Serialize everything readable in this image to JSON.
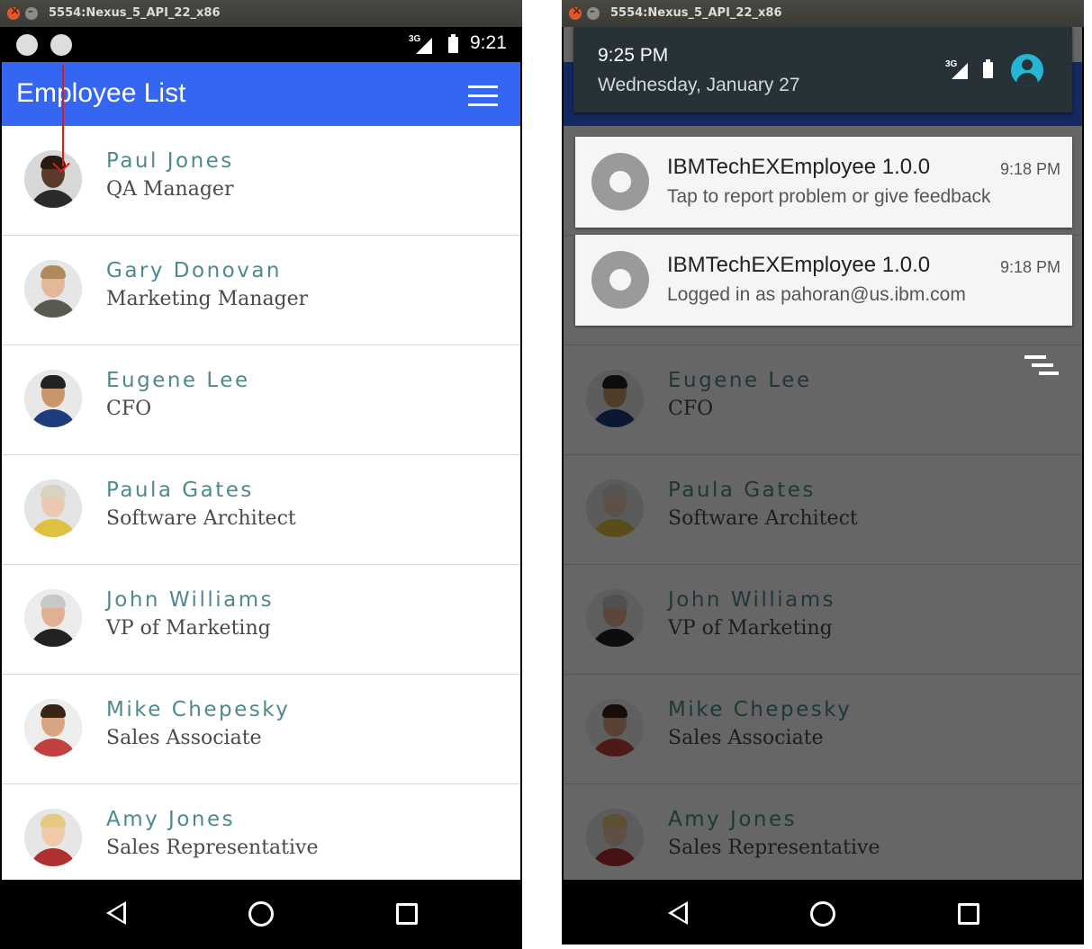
{
  "window_title": "5554:Nexus_5_API_22_x86",
  "status": {
    "network": "3G",
    "time": "9:21"
  },
  "app": {
    "title": "Employee List"
  },
  "employees": [
    {
      "name": "Paul Jones",
      "title": "QA Manager"
    },
    {
      "name": "Gary Donovan",
      "title": "Marketing Manager"
    },
    {
      "name": "Eugene Lee",
      "title": "CFO"
    },
    {
      "name": "Paula Gates",
      "title": "Software Architect"
    },
    {
      "name": "John Williams",
      "title": "VP of Marketing"
    },
    {
      "name": "Mike Chepesky",
      "title": "Sales Associate"
    },
    {
      "name": "Amy Jones",
      "title": "Sales Representative"
    }
  ],
  "shade": {
    "time": "9:25 PM",
    "date": "Wednesday, January 27",
    "network": "3G"
  },
  "notifications": [
    {
      "title": "IBMTechEXEmployee 1.0.0",
      "time": "9:18 PM",
      "text": "Tap to report problem or give feedback"
    },
    {
      "title": "IBMTechEXEmployee 1.0.0",
      "time": "9:18 PM",
      "text": "Logged in as pahoran@us.ibm.com"
    }
  ],
  "colors": {
    "app_bar": "#3466f2",
    "name_text": "#4e8a8c",
    "annotation_arrow": "#e01919",
    "shade_bg": "#263238"
  }
}
